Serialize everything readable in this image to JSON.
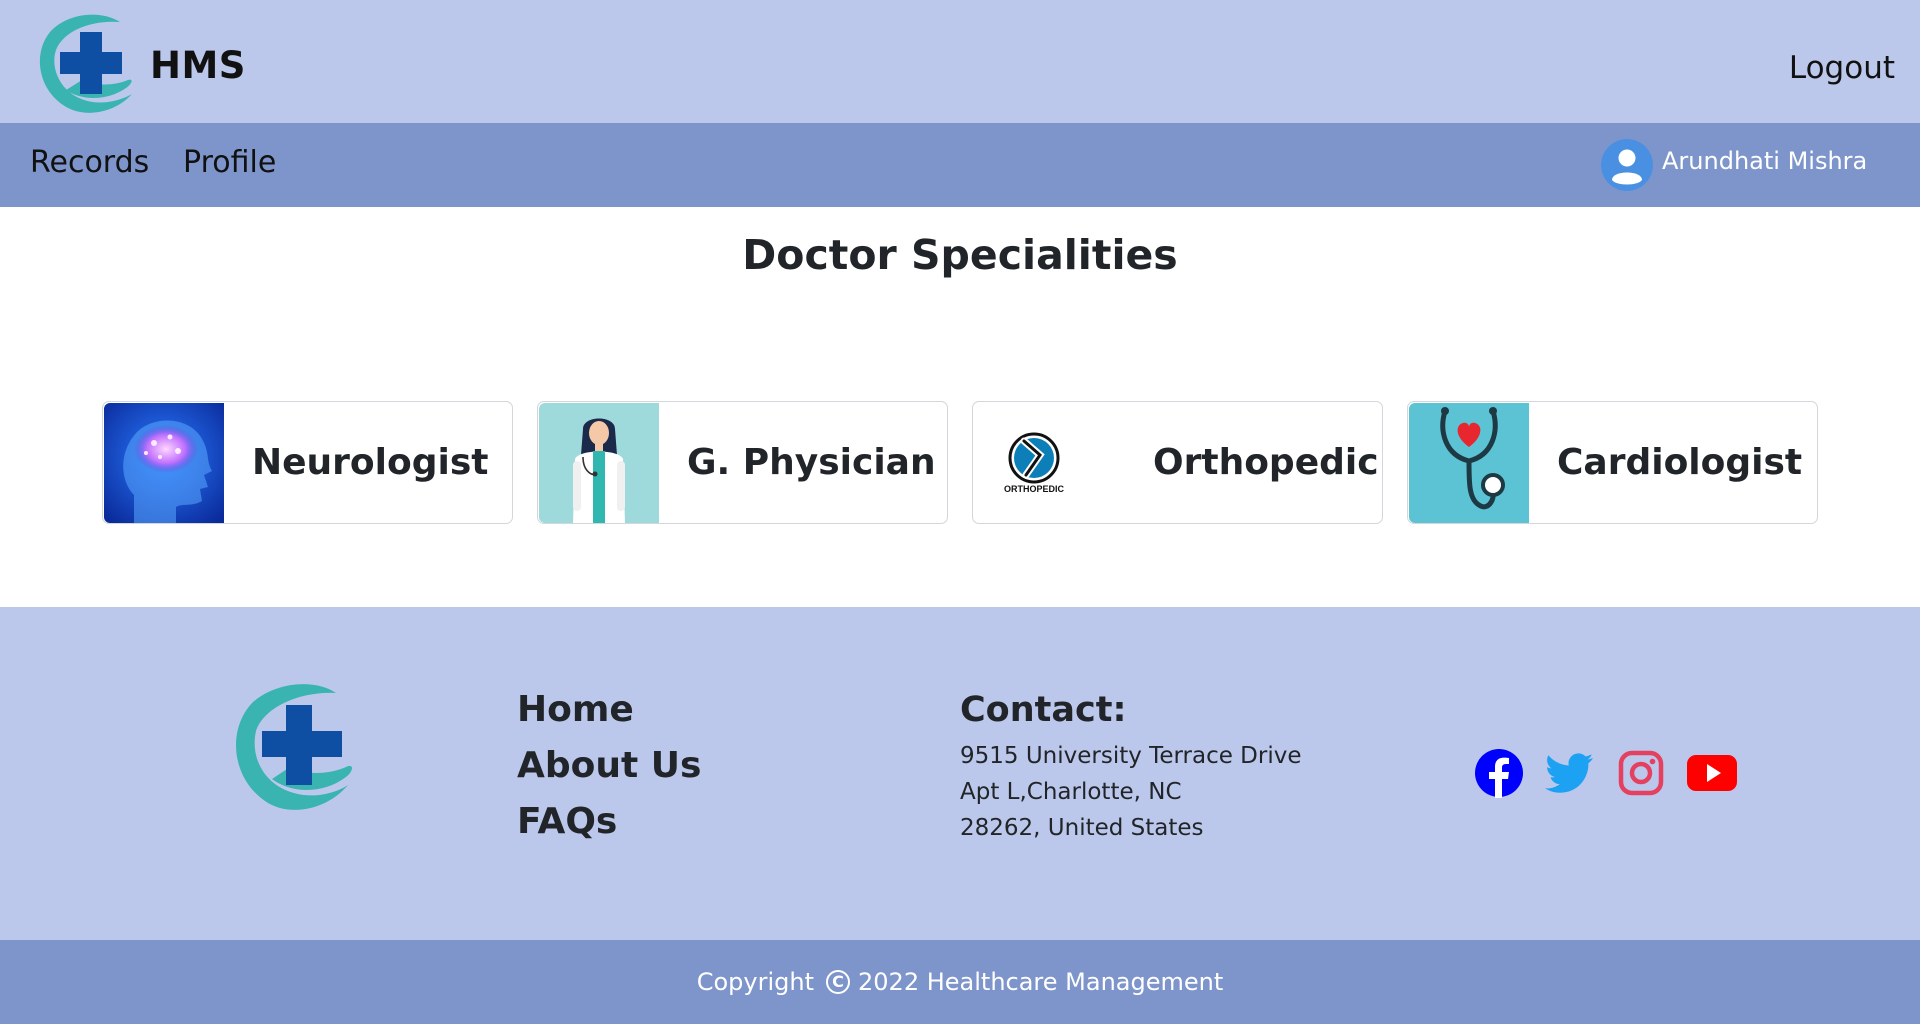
{
  "header": {
    "brand": "HMS",
    "logout_label": "Logout"
  },
  "nav": {
    "items": [
      {
        "label": "Records"
      },
      {
        "label": "Profile"
      }
    ],
    "user_name": "Arundhati Mishra"
  },
  "main": {
    "title": "Doctor Specialities",
    "specialities": [
      {
        "label": "Neurologist",
        "icon": "brain-image"
      },
      {
        "label": "G. Physician",
        "icon": "doctor-image"
      },
      {
        "label": "Orthopedic",
        "icon": "orthopedic-logo",
        "icon_text": "ORTHOPEDIC"
      },
      {
        "label": "Cardiologist",
        "icon": "stethoscope-heart-image"
      }
    ]
  },
  "footer": {
    "links": [
      {
        "label": "Home"
      },
      {
        "label": "About Us"
      },
      {
        "label": "FAQs"
      }
    ],
    "contact": {
      "title": "Contact:",
      "lines": [
        "9515 University Terrace Drive",
        "Apt L,Charlotte, NC",
        "28262, United States"
      ]
    },
    "socials": [
      {
        "name": "facebook-icon",
        "color": "#0000ff"
      },
      {
        "name": "twitter-icon",
        "color": "#1da1f2"
      },
      {
        "name": "instagram-icon",
        "color": "#e4405f"
      },
      {
        "name": "youtube-icon",
        "color": "#ff0000"
      }
    ]
  },
  "copyright": {
    "prefix": "Copyright",
    "symbol": "C",
    "text": "2022 Healthcare Management"
  },
  "colors": {
    "header_bg": "#bcc8eb",
    "nav_bg": "#7e95cb",
    "logo_teal": "#3ab4b0",
    "logo_blue": "#0f4fa3"
  }
}
